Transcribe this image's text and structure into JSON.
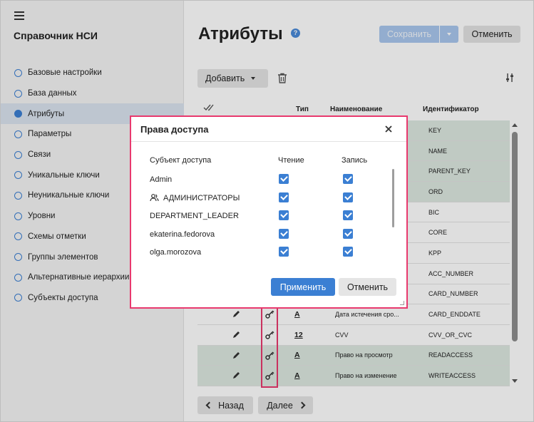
{
  "app": {
    "title": "Справочник НСИ"
  },
  "sidebar": {
    "items": [
      {
        "label": "Базовые настройки",
        "active": false
      },
      {
        "label": "База данных",
        "active": false
      },
      {
        "label": "Атрибуты",
        "active": true
      },
      {
        "label": "Параметры",
        "active": false
      },
      {
        "label": "Связи",
        "active": false
      },
      {
        "label": "Уникальные ключи",
        "active": false
      },
      {
        "label": "Неуникальные ключи",
        "active": false
      },
      {
        "label": "Уровни",
        "active": false
      },
      {
        "label": "Схемы отметки",
        "active": false
      },
      {
        "label": "Группы элементов",
        "active": false
      },
      {
        "label": "Альтернативные иерархии",
        "active": false
      },
      {
        "label": "Субъекты доступа",
        "active": false
      }
    ]
  },
  "header": {
    "title": "Атрибуты",
    "help_icon": "question-circle-icon",
    "help_glyph": "?",
    "save_label": "Сохранить",
    "cancel_label": "Отменить"
  },
  "toolbar": {
    "add_label": "Добавить"
  },
  "table": {
    "columns": {
      "type": "Тип",
      "name": "Наименование",
      "id": "Идентификатор"
    },
    "rows": [
      {
        "id": "KEY",
        "name": "",
        "type": "",
        "highlighted": true
      },
      {
        "id": "NAME",
        "name": "",
        "type": "",
        "highlighted": true
      },
      {
        "id": "PARENT_KEY",
        "name": "",
        "type": "",
        "highlighted": true
      },
      {
        "id": "ORD",
        "name": "",
        "type": "",
        "highlighted": true
      },
      {
        "id": "BIC",
        "name": "",
        "type": "",
        "highlighted": false
      },
      {
        "id": "CORE",
        "name": "",
        "type": "",
        "highlighted": false
      },
      {
        "id": "KPP",
        "name": "",
        "type": "",
        "highlighted": false
      },
      {
        "id": "ACC_NUMBER",
        "name": "",
        "type": "",
        "highlighted": false
      },
      {
        "id": "CARD_NUMBER",
        "name": "",
        "type": "",
        "highlighted": false
      },
      {
        "id": "CARD_ENDDATE",
        "name": "Дата истечения сро...",
        "type": "A",
        "highlighted": false
      },
      {
        "id": "CVV_OR_CVC",
        "name": "CVV",
        "type": "12",
        "highlighted": false
      },
      {
        "id": "READACCESS",
        "name": "Право на просмотр",
        "type": "A",
        "highlighted": true
      },
      {
        "id": "WRITEACCESS",
        "name": "Право на изменение",
        "type": "A",
        "highlighted": true
      }
    ]
  },
  "pagination": {
    "prev_label": "Назад",
    "next_label": "Далее"
  },
  "dialog": {
    "title": "Права доступа",
    "columns": {
      "subject": "Субъект доступа",
      "read": "Чтение",
      "write": "Запись"
    },
    "rows": [
      {
        "subject": "Admin",
        "group": false,
        "read": true,
        "write": true
      },
      {
        "subject": "АДМИНИСТРАТОРЫ",
        "group": true,
        "read": true,
        "write": true
      },
      {
        "subject": "DEPARTMENT_LEADER",
        "group": false,
        "read": true,
        "write": true
      },
      {
        "subject": "ekaterina.fedorova",
        "group": false,
        "read": true,
        "write": true
      },
      {
        "subject": "olga.morozova",
        "group": false,
        "read": true,
        "write": true
      }
    ],
    "apply_label": "Применить",
    "cancel_label": "Отменить"
  },
  "colors": {
    "accent": "#3b7fd3",
    "highlight_border": "#e8396e",
    "row_highlight": "#dde8e1",
    "nav_active": "#dbe4ef"
  }
}
